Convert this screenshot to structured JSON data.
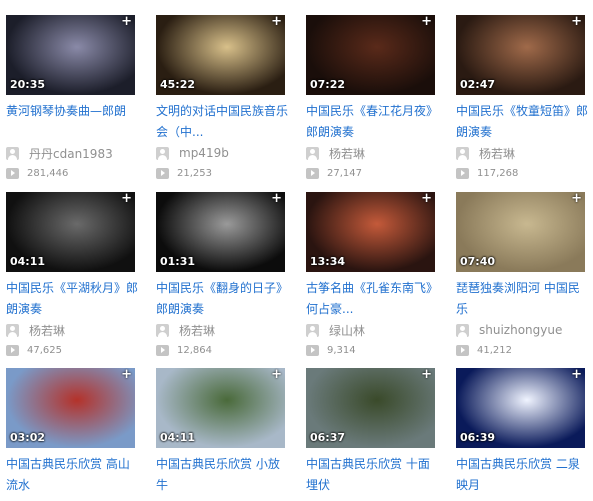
{
  "videos": [
    {
      "duration": "20:35",
      "title": "黄河钢琴协奏曲—郎朗",
      "uploader": "丹丹cdan1983",
      "plays": "281,446",
      "thumb_bg": "#1c1e2a",
      "thumb_accent": "#8a8aa8"
    },
    {
      "duration": "45:22",
      "title": "文明的对话中国民族音乐会（中...",
      "uploader": "mp419b",
      "plays": "21,253",
      "thumb_bg": "#2a1e12",
      "thumb_accent": "#d8c08a"
    },
    {
      "duration": "07:22",
      "title": "中国民乐《春江花月夜》郎朗演奏",
      "uploader": "杨若琳",
      "plays": "27,147",
      "thumb_bg": "#1a0e0a",
      "thumb_accent": "#5a2a1a"
    },
    {
      "duration": "02:47",
      "title": "中国民乐《牧童短笛》郎朗演奏",
      "uploader": "杨若琳",
      "plays": "117,268",
      "thumb_bg": "#2a1a12",
      "thumb_accent": "#a06a4a"
    },
    {
      "duration": "04:11",
      "title": "中国民乐《平湖秋月》郎朗演奏",
      "uploader": "杨若琳",
      "plays": "47,625",
      "thumb_bg": "#101010",
      "thumb_accent": "#6a6a6a"
    },
    {
      "duration": "01:31",
      "title": "中国民乐《翻身的日子》郎朗演奏",
      "uploader": "杨若琳",
      "plays": "12,864",
      "thumb_bg": "#0c0c0c",
      "thumb_accent": "#9a9a9a"
    },
    {
      "duration": "13:34",
      "title": "古筝名曲《孔雀东南飞》何占豪...",
      "uploader": "绿山林",
      "plays": "9,314",
      "thumb_bg": "#2a1410",
      "thumb_accent": "#c45a3a"
    },
    {
      "duration": "07:40",
      "title": "琵琶独奏浏阳河 中国民乐",
      "uploader": "shuizhongyue",
      "plays": "41,212",
      "thumb_bg": "#8a7a5a",
      "thumb_accent": "#c8b890"
    },
    {
      "duration": "03:02",
      "title": "中国古典民乐欣赏 高山流水",
      "uploader": "",
      "plays": "",
      "thumb_bg": "#7a9ac8",
      "thumb_accent": "#b4322a"
    },
    {
      "duration": "04:11",
      "title": "中国古典民乐欣赏 小放牛",
      "uploader": "",
      "plays": "",
      "thumb_bg": "#a8b8c8",
      "thumb_accent": "#4a6a3a"
    },
    {
      "duration": "06:37",
      "title": "中国古典民乐欣赏 十面埋伏",
      "uploader": "",
      "plays": "",
      "thumb_bg": "#6a7a7a",
      "thumb_accent": "#3a4a2a"
    },
    {
      "duration": "06:39",
      "title": "中国古典民乐欣赏 二泉映月",
      "uploader": "",
      "plays": "",
      "thumb_bg": "#0a1a5a",
      "thumb_accent": "#f0f4ff"
    }
  ],
  "add_symbol": "+"
}
